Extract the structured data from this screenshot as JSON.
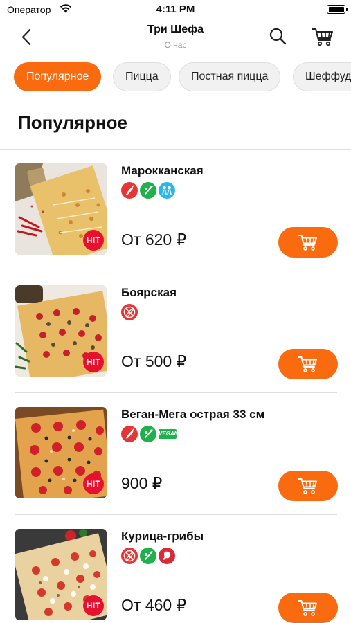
{
  "status_bar": {
    "carrier": "Оператор",
    "time": "4:11 PM"
  },
  "nav": {
    "title": "Три Шефа",
    "subtitle": "О нас"
  },
  "categories": [
    "Популярное",
    "Пицца",
    "Постная пицца",
    "Шеффуд"
  ],
  "active_category": "Популярное",
  "section_title": "Популярное",
  "accent_color": "#fa6a0e",
  "hit_badge_color": "#e8102f",
  "products": [
    {
      "name": "Марокканская",
      "price": "От 620 ₽",
      "badge": "HIT",
      "tags": [
        "spicy-icon",
        "vegetable-icon",
        "kids-icon"
      ]
    },
    {
      "name": "Боярская",
      "price": "От 500 ₽",
      "badge": "HIT",
      "tags": [
        "no-spicy-icon"
      ]
    },
    {
      "name": "Веган-Мега острая 33 см",
      "price": "900 ₽",
      "badge": "HIT",
      "tags": [
        "spicy-icon",
        "vegetable-icon",
        "vegan-icon"
      ],
      "vegan_label": "VEGAN"
    },
    {
      "name": "Курица-грибы",
      "price": "От 460 ₽",
      "badge": "HIT",
      "tags": [
        "no-spicy-icon",
        "vegetable-icon",
        "chicken-icon"
      ]
    }
  ]
}
